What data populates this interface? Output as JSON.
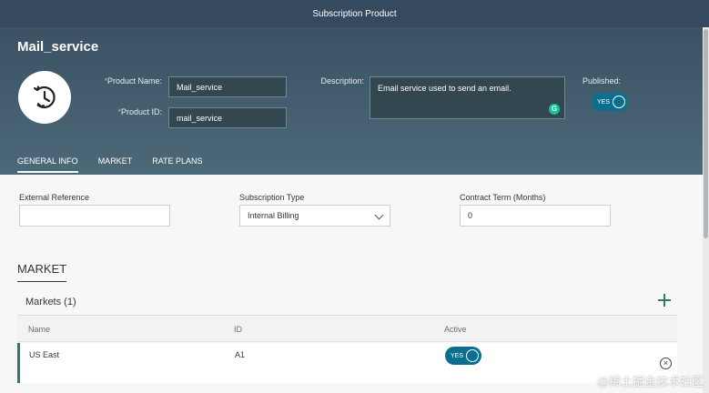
{
  "window": {
    "title": "Subscription Product"
  },
  "header": {
    "object_title": "Mail_service",
    "avatar_icon": "clock-history-icon",
    "product_name": {
      "label": "Product Name:",
      "required": "*",
      "value": "Mail_service"
    },
    "product_id": {
      "label": "Product ID:",
      "required": "*",
      "value": "mail_service"
    },
    "description": {
      "label": "Description:",
      "value": "Email service used to send an email."
    },
    "published": {
      "label": "Published:",
      "toggle_text": "YES"
    }
  },
  "tabs": [
    {
      "label": "GENERAL INFO",
      "active": true
    },
    {
      "label": "MARKET",
      "active": false
    },
    {
      "label": "RATE PLANS",
      "active": false
    }
  ],
  "general": {
    "external_reference": {
      "label": "External Reference",
      "value": ""
    },
    "subscription_type": {
      "label": "Subscription Type",
      "value": "Internal Billing"
    },
    "contract_term": {
      "label": "Contract Term (Months)",
      "value": "0"
    }
  },
  "market": {
    "section_title": "MARKET",
    "table_title": "Markets (1)",
    "columns": [
      "Name",
      "ID",
      "Active"
    ],
    "rows": [
      {
        "name": "US East",
        "id": "A1",
        "active": "YES"
      }
    ]
  },
  "watermark": "@稀土掘金技术社区",
  "colors": {
    "accent": "#0a6e8f",
    "shell": "#354a5f",
    "row_marker": "#2b7d6b"
  }
}
